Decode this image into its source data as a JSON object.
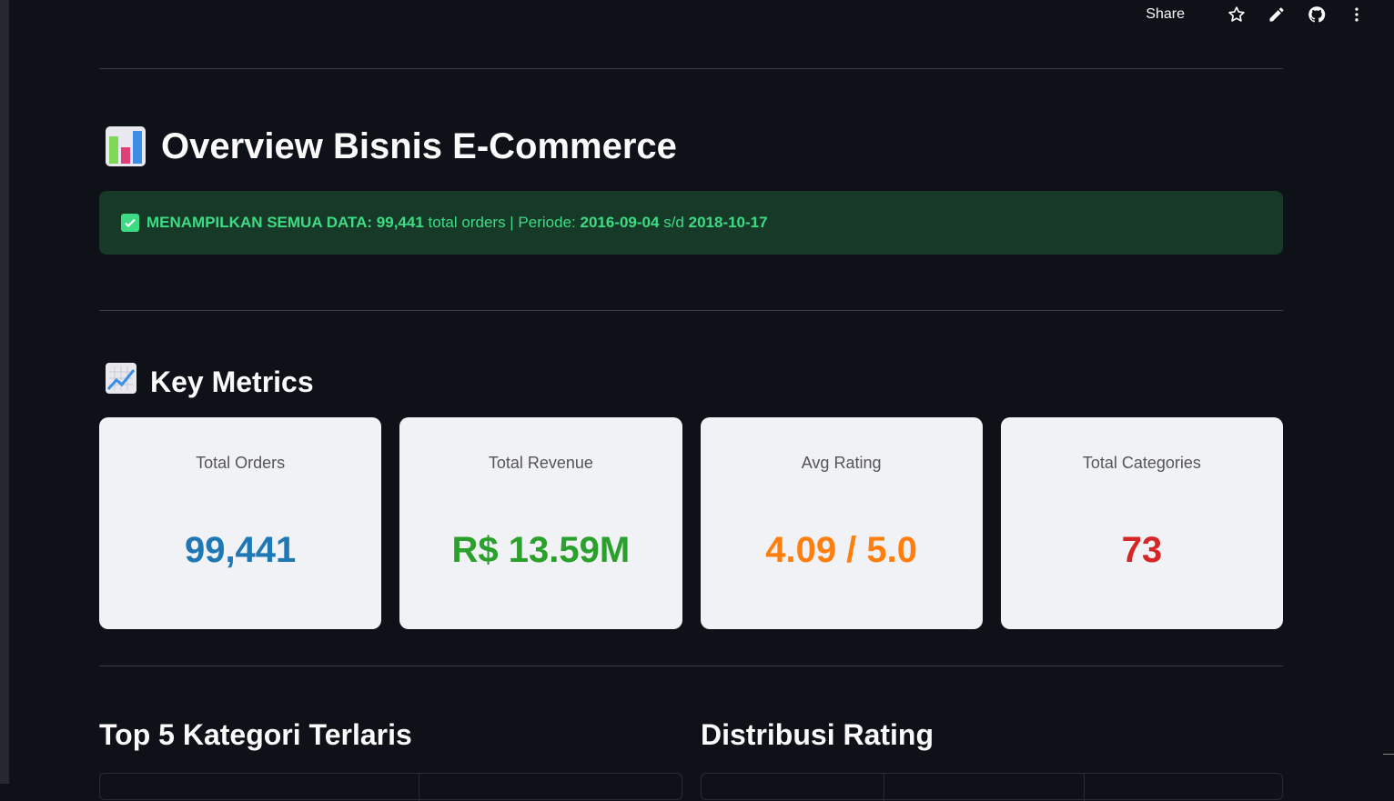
{
  "toolbar": {
    "share_label": "Share",
    "icons": [
      "star-icon",
      "edit-icon",
      "github-icon",
      "more-icon"
    ]
  },
  "header": {
    "title": "Overview Bisnis E-Commerce",
    "title_icon": "bar-chart-icon"
  },
  "banner": {
    "icon": "check-icon",
    "prefix": "MENAMPILKAN SEMUA DATA:",
    "orders": "99,441",
    "orders_suffix": "total orders | Periode:",
    "start_date": "2016-09-04",
    "separator": "s/d",
    "end_date": "2018-10-17",
    "bg_color": "#173928",
    "text_color": "#3ddc84"
  },
  "metrics_section": {
    "title": "Key Metrics",
    "icon": "trend-chart-icon",
    "cards": [
      {
        "label": "Total Orders",
        "value": "99,441",
        "color": "#1f77b4"
      },
      {
        "label": "Total Revenue",
        "value": "R$ 13.59M",
        "color": "#2ca02c"
      },
      {
        "label": "Avg Rating",
        "value": "4.09 / 5.0",
        "color": "#ff7f0e"
      },
      {
        "label": "Total Categories",
        "value": "73",
        "color": "#d62728"
      }
    ]
  },
  "charts": {
    "left_title": "Top 5 Kategori Terlaris",
    "right_title": "Distribusi Rating"
  }
}
